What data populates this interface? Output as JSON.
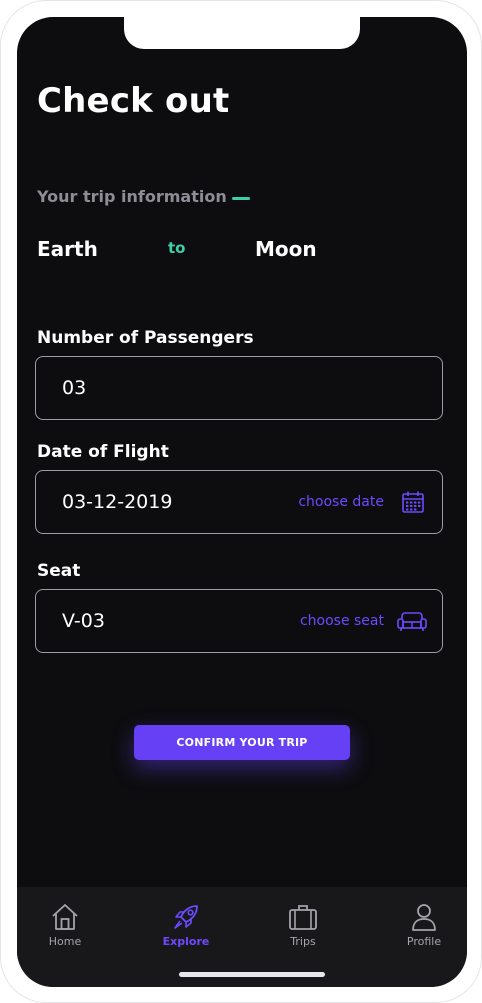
{
  "page": {
    "title": "Check out"
  },
  "trip": {
    "section_label": "Your trip information",
    "origin": "Earth",
    "connector": "to",
    "destination": "Moon"
  },
  "passengers": {
    "label": "Number of Passengers",
    "value": "03"
  },
  "flight_date": {
    "label": "Date of Flight",
    "value": "03-12-2019",
    "action_label": "choose date",
    "action_icon": "calendar-icon"
  },
  "seat": {
    "label": "Seat",
    "value": "V-03",
    "action_label": "choose seat",
    "action_icon": "sofa-icon"
  },
  "confirm_button": {
    "label": "CONFIRM YOUR TRIP"
  },
  "tab_bar": {
    "items": [
      {
        "label": "Home",
        "icon": "home-icon",
        "active": false
      },
      {
        "label": "Explore",
        "icon": "rocket-icon",
        "active": true
      },
      {
        "label": "Trips",
        "icon": "suitcase-icon",
        "active": false
      },
      {
        "label": "Profile",
        "icon": "person-icon",
        "active": false
      }
    ]
  },
  "colors": {
    "background": "#0d0d0f",
    "accent_purple": "#6540f5",
    "accent_green": "#3ecfa5",
    "muted_text": "#8d8d96",
    "tab_bar": "#18181b"
  }
}
